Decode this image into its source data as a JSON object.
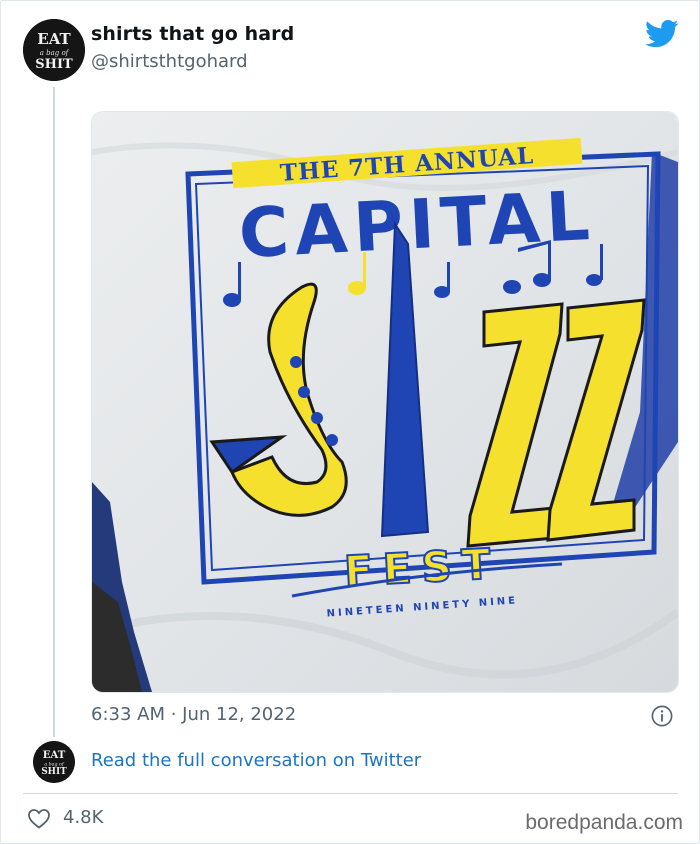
{
  "tweet": {
    "display_name": "shirts that go hard",
    "handle": "@shirtsthtgohard",
    "timestamp": "6:33 AM · Jun 12, 2022",
    "read_link": "Read the full conversation on Twitter",
    "likes": "4.8K"
  },
  "avatar": {
    "line1": "EAT",
    "line2": "a bag of",
    "line3": "SHIT"
  },
  "shirt": {
    "top_banner": "THE 7TH ANNUAL",
    "headline": "CAPITAL",
    "jazz": "JAZZ",
    "fest": "FEST",
    "year": "NINETEEN NINETY NINE"
  },
  "footer": {
    "brand": "boredpanda.com"
  },
  "colors": {
    "link": "#1b74c5",
    "twitter_blue": "#1d9bf0",
    "shirt_blue": "#1f45b5",
    "shirt_yellow": "#f5e12d"
  },
  "icons": [
    "twitter-bird-icon",
    "info-icon",
    "heart-icon"
  ]
}
